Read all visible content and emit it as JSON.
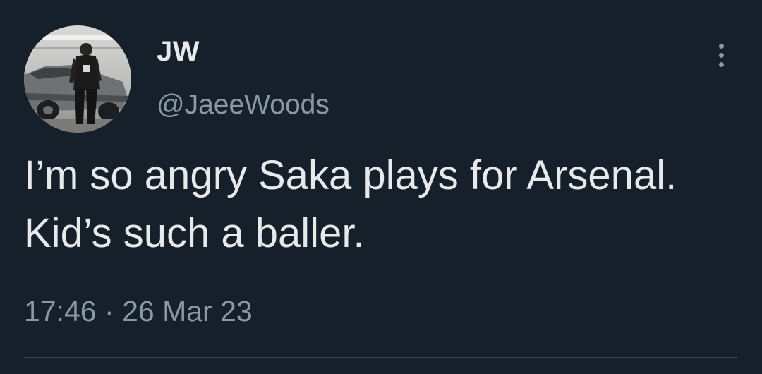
{
  "tweet": {
    "author": {
      "display_name": "JW",
      "handle": "@JaeeWoods",
      "avatar_icon": "profile-photo"
    },
    "text": "I’m so angry Saka plays for Arsenal. Kid’s such a baller.",
    "time": "17:46",
    "separator": "·",
    "date": "26 Mar 23",
    "more_icon": "more-vertical-icon"
  },
  "colors": {
    "background": "#15202b",
    "primary_text": "#e7e9ea",
    "secondary_text": "#8b98a5",
    "divider": "#38444d"
  }
}
